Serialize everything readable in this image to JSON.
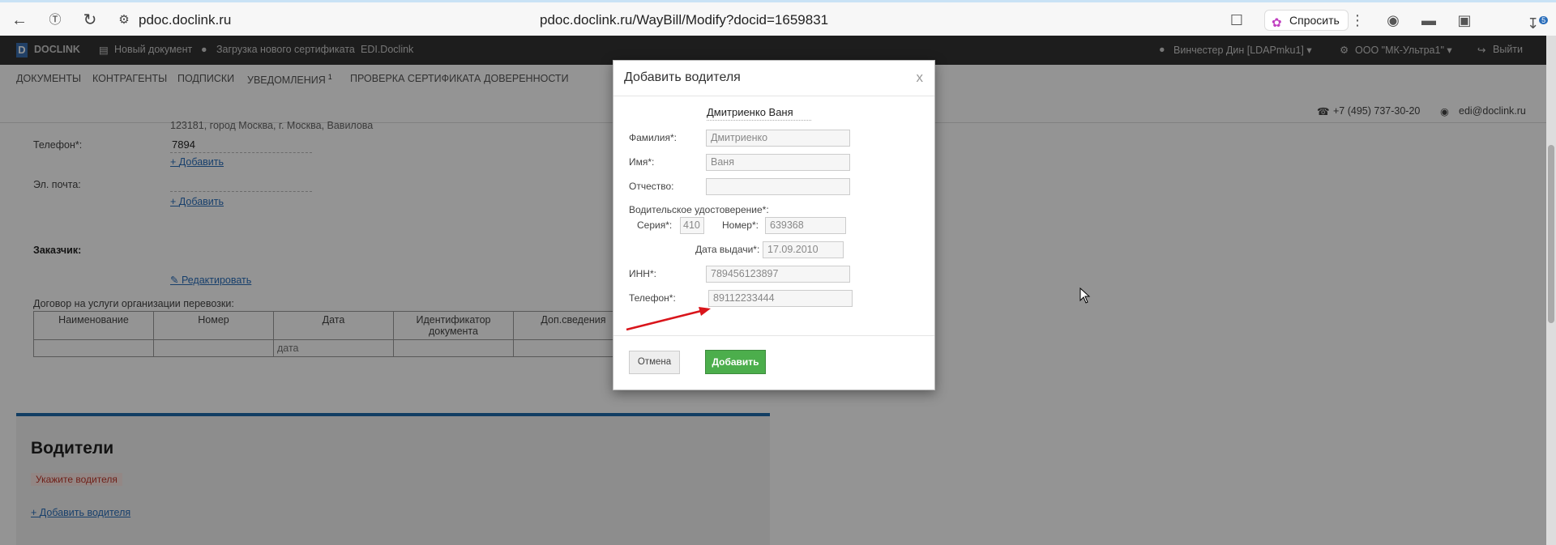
{
  "browser": {
    "url_short": "pdoc.doclink.ru",
    "url_full": "pdoc.doclink.ru/WayBill/Modify?docid=1659831",
    "ask_label": "Спросить",
    "downloads_badge": "5"
  },
  "header": {
    "logo_letter": "D",
    "logo_text": "DOCLINK",
    "new_doc": "Новый документ",
    "upload_cert": "Загрузка нового сертификата",
    "edi": "EDI.Doclink",
    "user": "Винчестер Дин [LDAPmku1]",
    "org": "ООО \"МК-Ультра1\"",
    "logout": "Выйти"
  },
  "nav": {
    "items": [
      {
        "label": "Документы"
      },
      {
        "label": "Контрагенты"
      },
      {
        "label": "Подписки"
      },
      {
        "label": "Уведомления",
        "badge": "1"
      },
      {
        "label": "Проверка сертификата"
      },
      {
        "label": "Доверенности"
      }
    ],
    "phone": "+7 (495) 737-30-20",
    "email": "edi@doclink.ru"
  },
  "content": {
    "address_partial": "123181, город Москва, г. Москва, Вавилова",
    "phone_label": "Телефон*:",
    "phone_value": "7894",
    "add_label": "Добавить",
    "email_label": "Эл. почта:",
    "customer_label": "Заказчик:",
    "edit_label": "Редактировать",
    "contract_label": "Договор на услуги организации перевозки:",
    "table_headers": [
      "Наименование",
      "Номер",
      "Дата",
      "Идентификатор документа",
      "Доп.сведения"
    ],
    "table_row": [
      "",
      "",
      "дата",
      "",
      ""
    ],
    "drivers_title": "Водители",
    "drivers_warning": "Укажите водителя",
    "add_driver": "Добавить водителя"
  },
  "modal": {
    "title": "Добавить водителя",
    "close": "x",
    "driver_name": "Дмитриенко Ваня",
    "surname_label": "Фамилия*:",
    "surname_value": "Дмитриенко",
    "name_label": "Имя*:",
    "name_value": "Ваня",
    "patronymic_label": "Отчество:",
    "patronymic_value": "",
    "license_label": "Водительское удостоверение*:",
    "series_label": "Серия*:",
    "series_value": "410",
    "number_label": "Номер*:",
    "number_value": "639368",
    "issue_date_label": "Дата выдачи*:",
    "issue_date_value": "17.09.2010",
    "inn_label": "ИНН*:",
    "inn_value": "789456123897",
    "phone_label": "Телефон*:",
    "phone_value": "89112233444",
    "cancel_label": "Отмена",
    "add_label": "Добавить"
  },
  "colors": {
    "accent_blue": "#1e6aab",
    "add_button_green": "#4cae4c",
    "annotation_arrow": "#d9151b",
    "warning_red": "#c0392b"
  }
}
